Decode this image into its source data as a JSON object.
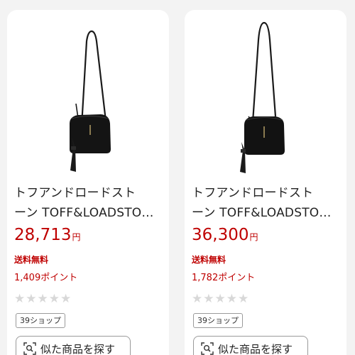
{
  "products": [
    {
      "title": "トフアンドロードスト\nーン TOFF&LOADSTO…",
      "price": "28,713",
      "currency": "円",
      "shipping": "送料無料",
      "points": "1,409ポイント",
      "rating_stars": "★★★★★",
      "shop_badge": "39ショップ",
      "similar_label": "似た商品を探す",
      "icon": "image-search-icon"
    },
    {
      "title": "トフアンドロードスト\nーン TOFF&LOADSTO…",
      "price": "36,300",
      "currency": "円",
      "shipping": "送料無料",
      "points": "1,782ポイント",
      "rating_stars": "★★★★★",
      "shop_badge": "39ショップ",
      "similar_label": "似た商品を探す",
      "icon": "image-search-icon"
    }
  ],
  "colors": {
    "price_red": "#bf0000",
    "star_gray": "#d8d8d8",
    "card_bg": "#ffffff",
    "page_bg": "#f3f3f3"
  }
}
